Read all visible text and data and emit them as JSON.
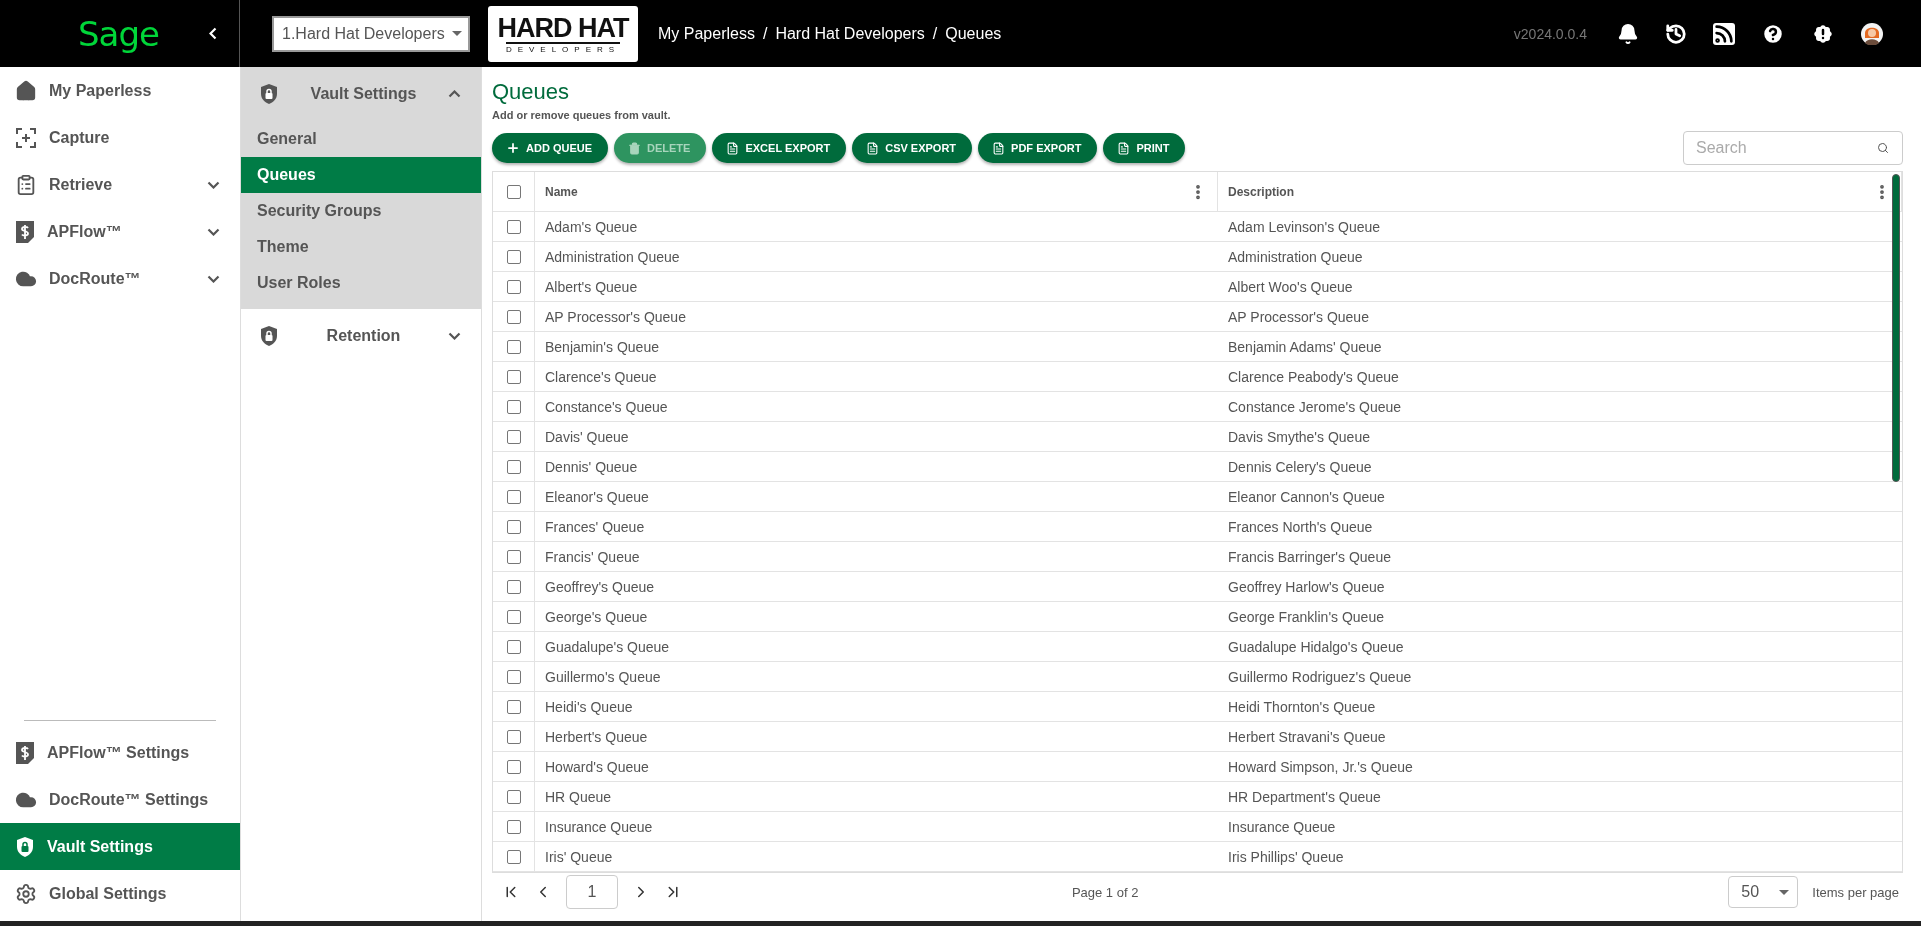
{
  "topbar": {
    "logo": "Sage",
    "vault_select": "1.Hard Hat Developers",
    "company_logo": {
      "line1": "HARD HAT",
      "line2": "DEVELOPERS"
    },
    "breadcrumbs": [
      "My Paperless",
      "Hard Hat Developers",
      "Queues"
    ],
    "breadcrumb_separator": "/",
    "version": "v2024.0.0.4"
  },
  "sidebar": {
    "items": [
      {
        "label": "My Paperless",
        "kind": "link"
      },
      {
        "label": "Capture",
        "kind": "link"
      },
      {
        "label": "Retrieve",
        "kind": "group",
        "expanded": false
      },
      {
        "label": "APFlow™",
        "kind": "group",
        "expanded": false
      },
      {
        "label": "DocRoute™",
        "kind": "group",
        "expanded": false
      }
    ],
    "settings_items": [
      {
        "label": "APFlow™ Settings",
        "selected": false
      },
      {
        "label": "DocRoute™ Settings",
        "selected": false
      },
      {
        "label": "Vault Settings",
        "selected": true
      },
      {
        "label": "Global Settings",
        "selected": false
      }
    ]
  },
  "submenu": [
    {
      "label": "Vault Settings",
      "expanded": true,
      "children": [
        {
          "label": "General",
          "selected": false
        },
        {
          "label": "Queues",
          "selected": true
        },
        {
          "label": "Security Groups",
          "selected": false
        },
        {
          "label": "Theme",
          "selected": false
        },
        {
          "label": "User Roles",
          "selected": false
        }
      ]
    },
    {
      "label": "Retention",
      "expanded": false
    }
  ],
  "page": {
    "title": "Queues",
    "subtitle": "Add or remove queues from vault.",
    "toolbar": [
      {
        "label": "ADD QUEUE",
        "kind": "add",
        "disabled": false
      },
      {
        "label": "DELETE",
        "kind": "delete",
        "disabled": true
      },
      {
        "label": "EXCEL EXPORT",
        "kind": "export",
        "disabled": false
      },
      {
        "label": "CSV EXPORT",
        "kind": "export",
        "disabled": false
      },
      {
        "label": "PDF EXPORT",
        "kind": "export",
        "disabled": false
      },
      {
        "label": "PRINT",
        "kind": "export",
        "disabled": false
      }
    ],
    "search": {
      "placeholder": "Search"
    }
  },
  "table": {
    "columns": [
      "Name",
      "Description"
    ],
    "header_checked": false,
    "rows": [
      {
        "name": "Adam's Queue",
        "description": "Adam Levinson's Queue",
        "checked": false
      },
      {
        "name": "Administration Queue",
        "description": "Administration Queue",
        "checked": false
      },
      {
        "name": "Albert's Queue",
        "description": "Albert Woo's Queue",
        "checked": false
      },
      {
        "name": "AP Processor's Queue",
        "description": "AP Processor's Queue",
        "checked": false
      },
      {
        "name": "Benjamin's Queue",
        "description": "Benjamin Adams' Queue",
        "checked": false
      },
      {
        "name": "Clarence's Queue",
        "description": "Clarence Peabody's Queue",
        "checked": false
      },
      {
        "name": "Constance's Queue",
        "description": "Constance Jerome's Queue",
        "checked": false
      },
      {
        "name": "Davis' Queue",
        "description": "Davis Smythe's Queue",
        "checked": false
      },
      {
        "name": "Dennis' Queue",
        "description": "Dennis Celery's Queue",
        "checked": false
      },
      {
        "name": "Eleanor's Queue",
        "description": "Eleanor Cannon's Queue",
        "checked": false
      },
      {
        "name": "Frances' Queue",
        "description": "Frances North's Queue",
        "checked": false
      },
      {
        "name": "Francis' Queue",
        "description": "Francis Barringer's Queue",
        "checked": false
      },
      {
        "name": "Geoffrey's Queue",
        "description": "Geoffrey Harlow's Queue",
        "checked": false
      },
      {
        "name": "George's Queue",
        "description": "George Franklin's Queue",
        "checked": false
      },
      {
        "name": "Guadalupe's Queue",
        "description": "Guadalupe Hidalgo's Queue",
        "checked": false
      },
      {
        "name": "Guillermo's Queue",
        "description": "Guillermo Rodriguez's Queue",
        "checked": false
      },
      {
        "name": "Heidi's Queue",
        "description": "Heidi Thornton's Queue",
        "checked": false
      },
      {
        "name": "Herbert's Queue",
        "description": "Herbert Stravani's Queue",
        "checked": false
      },
      {
        "name": "Howard's Queue",
        "description": "Howard Simpson, Jr.'s Queue",
        "checked": false
      },
      {
        "name": "HR Queue",
        "description": "HR Department's Queue",
        "checked": false
      },
      {
        "name": "Insurance Queue",
        "description": "Insurance Queue",
        "checked": false
      },
      {
        "name": "Iris' Queue",
        "description": "Iris Phillips' Queue",
        "checked": false
      }
    ]
  },
  "pagination": {
    "page": "1",
    "page_info": "Page 1 of 2",
    "per_page": "50",
    "per_page_label": "Items per page"
  }
}
